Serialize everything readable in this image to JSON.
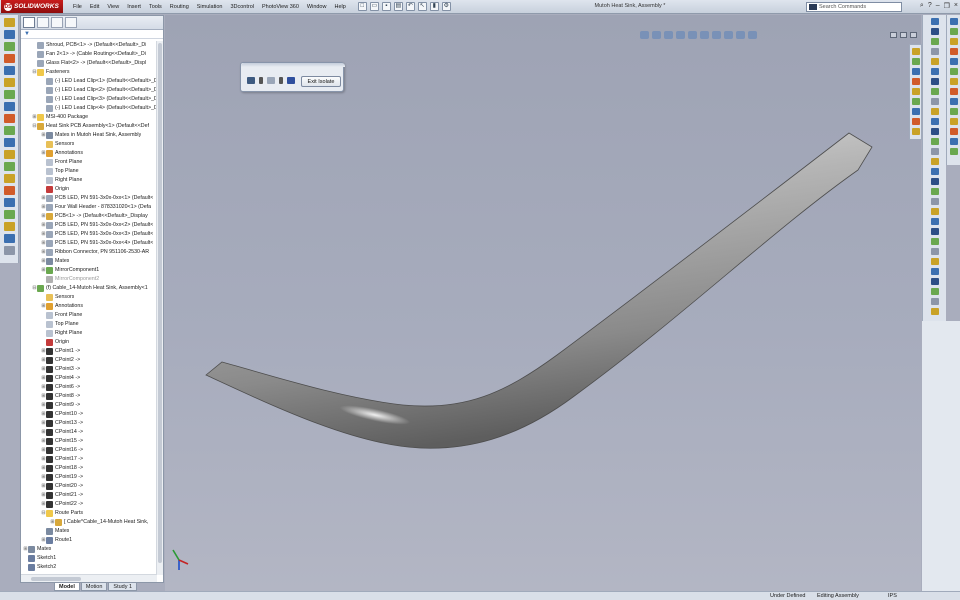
{
  "app": {
    "logo_text": "SOLIDWORKS",
    "document_title": "Mutoh Heat Sink, Assembly *"
  },
  "menu": [
    "File",
    "Edit",
    "View",
    "Insert",
    "Tools",
    "Routing",
    "Simulation",
    "3Dcontrol",
    "PhotoView 360",
    "Window",
    "Help"
  ],
  "search": {
    "placeholder": "Search Commands"
  },
  "confirm_bar": {
    "exit_label": "Exit Isolate"
  },
  "tree": [
    {
      "label": "Shroud, PCB<1> -> (Default<<Default>_Di",
      "indent": 1,
      "icon": "part-icon",
      "color": "#9aa6b8"
    },
    {
      "label": "Fan 2<1> -> (Cable Routing<<Default>_Di",
      "indent": 1,
      "icon": "part-icon",
      "color": "#9aa6b8"
    },
    {
      "label": "Glass Flat<2> -> (Default<<Default>_Displ",
      "indent": 1,
      "icon": "part-icon",
      "color": "#9aa6b8"
    },
    {
      "label": "Fasteners",
      "indent": 1,
      "icon": "folder-icon",
      "color": "#f0c84a",
      "exp": "-"
    },
    {
      "label": "(-) LED Lead Clip<1> (Default<<Default>_D",
      "indent": 2,
      "icon": "part-icon",
      "color": "#9aa6b8"
    },
    {
      "label": "(-) LED Lead Clip<2> (Default<<Default>_D",
      "indent": 2,
      "icon": "part-icon",
      "color": "#9aa6b8"
    },
    {
      "label": "(-) LED Lead Clip<3> (Default<<Default>_D",
      "indent": 2,
      "icon": "part-icon",
      "color": "#9aa6b8"
    },
    {
      "label": "(-) LED Lead Clip<4> (Default<<Default>_D",
      "indent": 2,
      "icon": "part-icon",
      "color": "#9aa6b8"
    },
    {
      "label": "MSI-400 Package",
      "indent": 1,
      "icon": "folder-icon",
      "color": "#f0c84a",
      "exp": "+"
    },
    {
      "label": "Heat Sink PCB Assembly<1> (Default<<Def",
      "indent": 1,
      "icon": "assembly-icon",
      "color": "#d8a83a",
      "exp": "-"
    },
    {
      "label": "Mates in Mutoh Heat Sink, Assembly",
      "indent": 2,
      "icon": "mates-icon",
      "color": "#7b8aa0",
      "exp": "+"
    },
    {
      "label": "Sensors",
      "indent": 2,
      "icon": "sensor-icon",
      "color": "#e8c057"
    },
    {
      "label": "Annotations",
      "indent": 2,
      "icon": "annotation-icon",
      "color": "#e0a030",
      "exp": "+"
    },
    {
      "label": "Front Plane",
      "indent": 2,
      "icon": "plane-icon",
      "color": "#b9c2d0"
    },
    {
      "label": "Top Plane",
      "indent": 2,
      "icon": "plane-icon",
      "color": "#b9c2d0"
    },
    {
      "label": "Right Plane",
      "indent": 2,
      "icon": "plane-icon",
      "color": "#b9c2d0"
    },
    {
      "label": "Origin",
      "indent": 2,
      "icon": "origin-icon",
      "color": "#c43b3b"
    },
    {
      "label": "PCB LED, PN 591-3x0x-0xx<1> (Default<",
      "indent": 2,
      "icon": "part-icon",
      "color": "#9aa6b8",
      "exp": "+"
    },
    {
      "label": "Four Wall Header - 878331020<1> (Defa",
      "indent": 2,
      "icon": "part-icon",
      "color": "#9aa6b8",
      "exp": "+"
    },
    {
      "label": "PCB<1> -> (Default<<Default>_Display",
      "indent": 2,
      "icon": "part-icon",
      "color": "#d8a83a",
      "exp": "+"
    },
    {
      "label": "PCB LED, PN 591-3x0x-0xx<2> (Default<",
      "indent": 2,
      "icon": "part-icon",
      "color": "#9aa6b8",
      "exp": "+"
    },
    {
      "label": "PCB LED, PN 591-3x0x-0xx<3> (Default<",
      "indent": 2,
      "icon": "part-icon",
      "color": "#9aa6b8",
      "exp": "+"
    },
    {
      "label": "PCB LED, PN 591-3x0x-0xx<4> (Default<",
      "indent": 2,
      "icon": "part-icon",
      "color": "#9aa6b8",
      "exp": "+"
    },
    {
      "label": "Ribbon Connector, PN 951106-2530-AR",
      "indent": 2,
      "icon": "part-icon",
      "color": "#9aa6b8",
      "exp": "+"
    },
    {
      "label": "Mates",
      "indent": 2,
      "icon": "mates-icon",
      "color": "#7b8aa0",
      "exp": "+"
    },
    {
      "label": "MirrorComponent1",
      "indent": 2,
      "icon": "mirror-icon",
      "color": "#6aa84f",
      "exp": "+"
    },
    {
      "label": "MirrorComponent2",
      "indent": 2,
      "icon": "mirror-icon",
      "color": "#b0b0b0",
      "dim": true
    },
    {
      "label": "(f) Cable_14-Mutoh Heat Sink, Assembly<1",
      "indent": 1,
      "icon": "assembly-icon",
      "color": "#6aa84f",
      "exp": "-"
    },
    {
      "label": "Sensors",
      "indent": 2,
      "icon": "sensor-icon",
      "color": "#e8c057"
    },
    {
      "label": "Annotations",
      "indent": 2,
      "icon": "annotation-icon",
      "color": "#e0a030",
      "exp": "+"
    },
    {
      "label": "Front Plane",
      "indent": 2,
      "icon": "plane-icon",
      "color": "#b9c2d0"
    },
    {
      "label": "Top Plane",
      "indent": 2,
      "icon": "plane-icon",
      "color": "#b9c2d0"
    },
    {
      "label": "Right Plane",
      "indent": 2,
      "icon": "plane-icon",
      "color": "#b9c2d0"
    },
    {
      "label": "Origin",
      "indent": 2,
      "icon": "origin-icon",
      "color": "#c43b3b"
    },
    {
      "label": "CPoint1 ->",
      "indent": 2,
      "icon": "cpoint-icon",
      "color": "#333",
      "exp": "+"
    },
    {
      "label": "CPoint2 ->",
      "indent": 2,
      "icon": "cpoint-icon",
      "color": "#333",
      "exp": "+"
    },
    {
      "label": "CPoint3 ->",
      "indent": 2,
      "icon": "cpoint-icon",
      "color": "#333",
      "exp": "+"
    },
    {
      "label": "CPoint4 ->",
      "indent": 2,
      "icon": "cpoint-icon",
      "color": "#333",
      "exp": "+"
    },
    {
      "label": "CPoint6 ->",
      "indent": 2,
      "icon": "cpoint-icon",
      "color": "#333",
      "exp": "+"
    },
    {
      "label": "CPoint8 ->",
      "indent": 2,
      "icon": "cpoint-icon",
      "color": "#333",
      "exp": "+"
    },
    {
      "label": "CPoint9 ->",
      "indent": 2,
      "icon": "cpoint-icon",
      "color": "#333",
      "exp": "+"
    },
    {
      "label": "CPoint10 ->",
      "indent": 2,
      "icon": "cpoint-icon",
      "color": "#333",
      "exp": "+"
    },
    {
      "label": "CPoint13 ->",
      "indent": 2,
      "icon": "cpoint-icon",
      "color": "#333",
      "exp": "+"
    },
    {
      "label": "CPoint14 ->",
      "indent": 2,
      "icon": "cpoint-icon",
      "color": "#333",
      "exp": "+"
    },
    {
      "label": "CPoint15 ->",
      "indent": 2,
      "icon": "cpoint-icon",
      "color": "#333",
      "exp": "+"
    },
    {
      "label": "CPoint16 ->",
      "indent": 2,
      "icon": "cpoint-icon",
      "color": "#333",
      "exp": "+"
    },
    {
      "label": "CPoint17 ->",
      "indent": 2,
      "icon": "cpoint-icon",
      "color": "#333",
      "exp": "+"
    },
    {
      "label": "CPoint18 ->",
      "indent": 2,
      "icon": "cpoint-icon",
      "color": "#333",
      "exp": "+"
    },
    {
      "label": "CPoint19 ->",
      "indent": 2,
      "icon": "cpoint-icon",
      "color": "#333",
      "exp": "+"
    },
    {
      "label": "CPoint20 ->",
      "indent": 2,
      "icon": "cpoint-icon",
      "color": "#333",
      "exp": "+"
    },
    {
      "label": "CPoint21 ->",
      "indent": 2,
      "icon": "cpoint-icon",
      "color": "#333",
      "exp": "+"
    },
    {
      "label": "CPoint22 ->",
      "indent": 2,
      "icon": "cpoint-icon",
      "color": "#333",
      "exp": "+"
    },
    {
      "label": "Route Parts",
      "indent": 2,
      "icon": "folder-icon",
      "color": "#f0c84a",
      "exp": "-"
    },
    {
      "label": "[ Cable^Cable_14-Mutoh Heat Sink,",
      "indent": 3,
      "icon": "part-icon",
      "color": "#d8a83a",
      "exp": "+"
    },
    {
      "label": "Mates",
      "indent": 2,
      "icon": "mates-icon",
      "color": "#7b8aa0"
    },
    {
      "label": "Route1",
      "indent": 2,
      "icon": "route-icon",
      "color": "#6a7da0",
      "exp": "+"
    },
    {
      "label": "Mates",
      "indent": 0,
      "icon": "mates-icon",
      "color": "#7b8aa0",
      "exp": "+"
    },
    {
      "label": "Sketch1",
      "indent": 0,
      "icon": "sketch-icon",
      "color": "#6a7da0"
    },
    {
      "label": "Sketch2",
      "indent": 0,
      "icon": "sketch-icon",
      "color": "#6a7da0"
    }
  ],
  "bottom_tabs": [
    "Model",
    "Motion",
    "Study 1"
  ],
  "status": {
    "definition": "Under Defined",
    "mode": "Editing Assembly",
    "units": "IPS"
  },
  "colors": {
    "accent": "#c91c1c",
    "background": "#a9adbd",
    "cable": "#9c9c9c"
  }
}
